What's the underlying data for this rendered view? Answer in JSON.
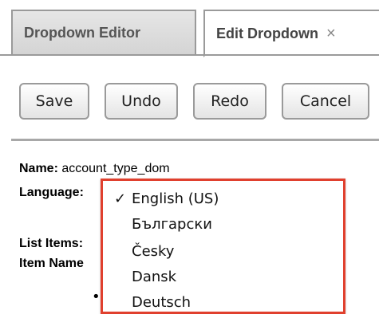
{
  "tabs": [
    {
      "label": "Dropdown Editor",
      "active": false
    },
    {
      "label": "Edit Dropdown",
      "active": true,
      "close_glyph": "×"
    }
  ],
  "buttons": {
    "save": "Save",
    "undo": "Undo",
    "redo": "Redo",
    "cancel": "Cancel"
  },
  "form": {
    "name_label": "Name:",
    "name_value": "account_type_dom",
    "language_label": "Language:",
    "list_items_label": "List Items:",
    "item_name_label": "Item Name"
  },
  "language_dropdown": {
    "selected": "English (US)",
    "check_glyph": "✓",
    "options": [
      "English (US)",
      "Български",
      "Česky",
      "Dansk",
      "Deutsch"
    ]
  },
  "colors": {
    "highlight_border": "#e0402e",
    "tab_border": "#9a9a9a"
  }
}
